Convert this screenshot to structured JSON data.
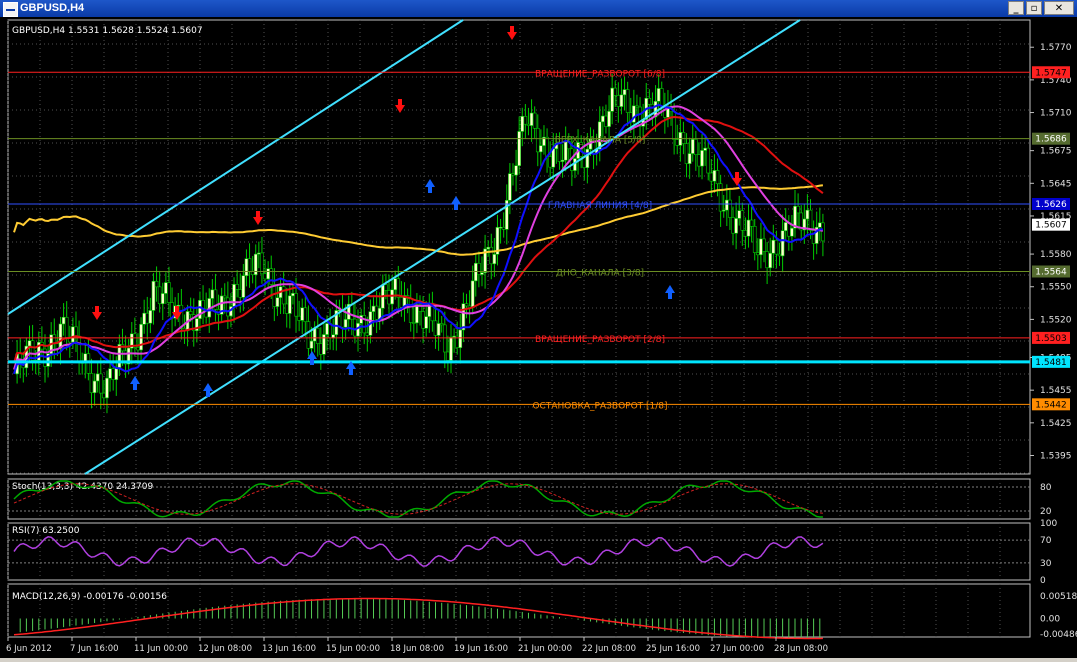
{
  "window": {
    "title": "GBPUSD,H4",
    "controls": [
      "minimize",
      "restore",
      "close"
    ]
  },
  "main_panel": {
    "header": "GBPUSD,H4  1.5531 1.5628 1.5524 1.5607",
    "price_ticks": [
      "1.5770",
      "1.5740",
      "1.5710",
      "1.5675",
      "1.5645",
      "1.5615",
      "1.5580",
      "1.5550",
      "1.5520",
      "1.5485",
      "1.5455",
      "1.5425",
      "1.5395"
    ],
    "current_price": "1.5607",
    "levels": [
      {
        "price": 1.5747,
        "label": "ВРАЩЕНИЕ_РАЗВОРОТ [6/8]",
        "tag": "1.5747",
        "color": "#ff2020",
        "bg": "#ff2020",
        "tagtext": "#000000"
      },
      {
        "price": 1.5686,
        "label": "ВЕРХ_КАНАЛА [5/8]",
        "tag": "1.5686",
        "color": "#6b8e23",
        "bg": "#556b2f",
        "tagtext": "#ffffff"
      },
      {
        "price": 1.5626,
        "label": "ГЛАВНАЯ ЛИНИЯ [4/8]",
        "tag": "1.5626",
        "color": "#3050ff",
        "bg": "#0000cc",
        "tagtext": "#ffffff"
      },
      {
        "price": 1.5564,
        "label": "ДНО_КАНАЛА [3/8]",
        "tag": "1.5564",
        "color": "#6b8e23",
        "bg": "#556b2f",
        "tagtext": "#ffffff"
      },
      {
        "price": 1.5503,
        "label": "ВРАЩЕНИЕ_РАЗВОРОТ [2/8]",
        "tag": "1.5503",
        "color": "#ff2020",
        "bg": "#ff2020",
        "tagtext": "#000000"
      },
      {
        "price": 1.5481,
        "label": "",
        "tag": "1.5481",
        "color": "#00e5ff",
        "bg": "#00e5ff",
        "tagtext": "#000000"
      },
      {
        "price": 1.5442,
        "label": "ОСТАНОВКА_РАЗВОРОТ [1/8]",
        "tag": "1.5442",
        "color": "#ff8c00",
        "bg": "#ff8c00",
        "tagtext": "#000000"
      }
    ]
  },
  "stoch_panel": {
    "header": "Stoch(13,3,3) 42.4370 24.3709",
    "ticks": [
      "80",
      "20"
    ]
  },
  "rsi_panel": {
    "header": "RSI(7) 63.2500",
    "ticks": [
      "100",
      "70",
      "30",
      "0"
    ]
  },
  "macd_panel": {
    "header": "MACD(12,26,9) -0.00176 -0.00156",
    "ticks": [
      "0.00518",
      "0.00",
      "-0.00486"
    ]
  },
  "time_axis": [
    "6 Jun 2012",
    "7 Jun 16:00",
    "11 Jun 00:00",
    "12 Jun 08:00",
    "13 Jun 16:00",
    "15 Jun 00:00",
    "18 Jun 08:00",
    "19 Jun 16:00",
    "21 Jun 00:00",
    "22 Jun 08:00",
    "25 Jun 16:00",
    "27 Jun 00:00",
    "28 Jun 08:00"
  ],
  "colors": {
    "bull_candle": "#ffffcc",
    "bear_candle": "#000000",
    "wick": "#00cc00",
    "ma_slow": "#ffcc33",
    "ma_red": "#e01010",
    "ma_magenta": "#e040e0",
    "ma_blue": "#1010ff",
    "channel": "#40e0ff",
    "arrow_down": "#ff1010",
    "arrow_up": "#1060ff"
  }
}
